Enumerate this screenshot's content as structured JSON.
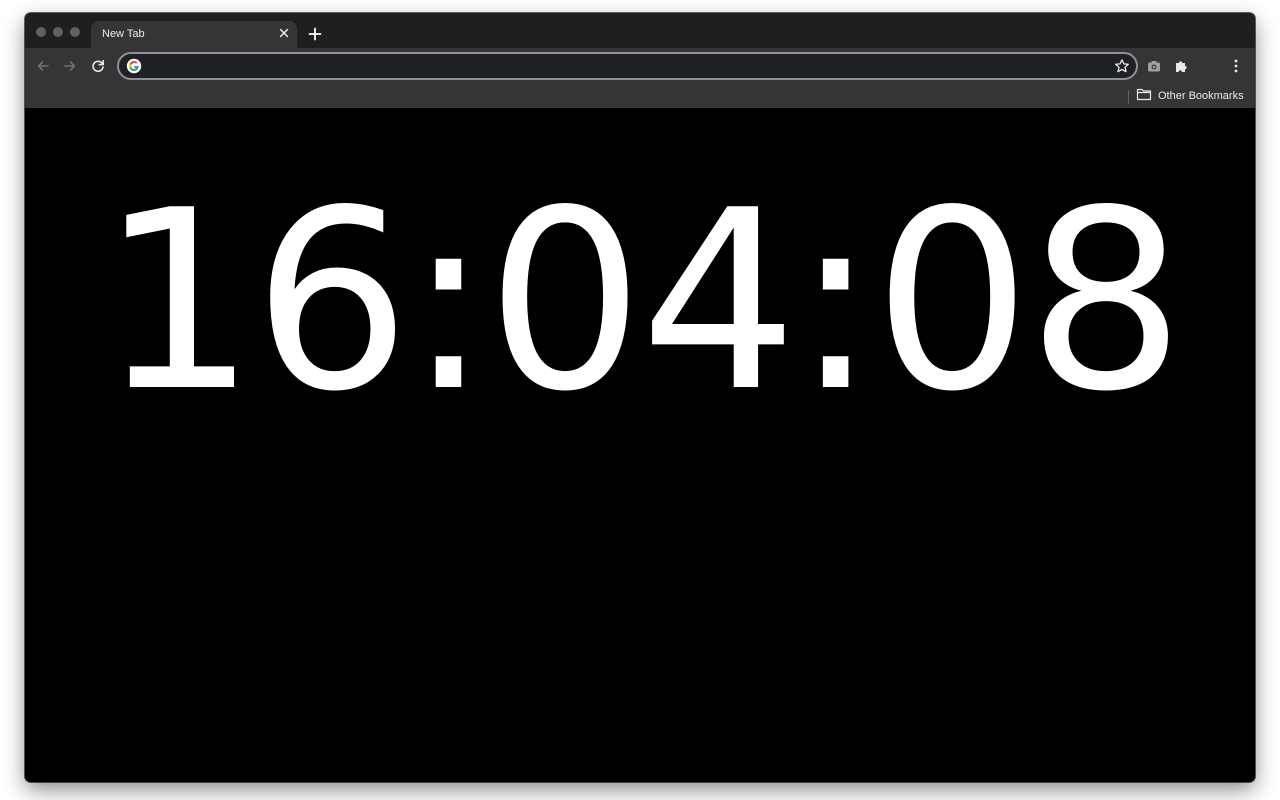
{
  "browser": {
    "tab": {
      "title": "New Tab"
    },
    "omnibox": {
      "value": "",
      "placeholder": ""
    },
    "bookmarks": {
      "other_label": "Other Bookmarks"
    },
    "icons": [
      "back-icon",
      "forward-icon",
      "reload-icon",
      "google-icon",
      "star-icon",
      "camera-icon",
      "puzzle-icon",
      "kebab-menu-icon",
      "folder-icon",
      "close-icon",
      "plus-icon"
    ]
  },
  "clock": {
    "time": "16:04:08"
  },
  "colors": {
    "page_background": "#000000",
    "clock_text": "#ffffff",
    "toolbar": "#353535",
    "titlebar": "#1f1f1f"
  }
}
